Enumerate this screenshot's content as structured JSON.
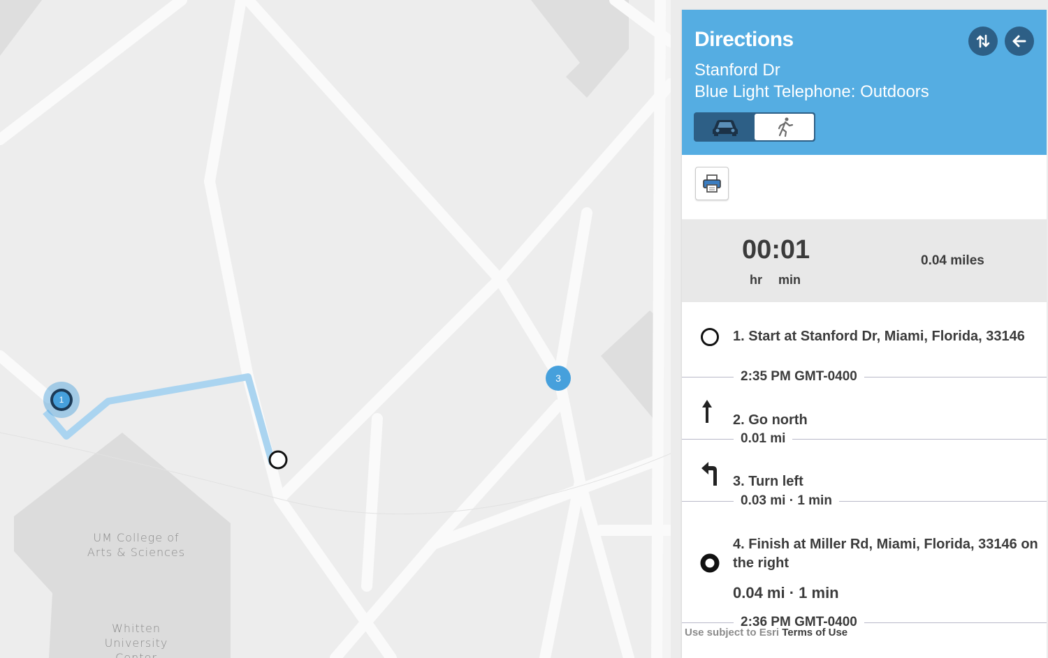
{
  "map": {
    "labels": {
      "college": "UM College of\nArts & Sciences",
      "whitten": "Whitten\nUniversity\nCenter"
    },
    "markers": {
      "stop1": "1",
      "stop3": "3"
    }
  },
  "panel": {
    "title": "Directions",
    "origin": "Stanford Dr",
    "destination": "Blue Light Telephone: Outdoors",
    "travel_modes": {
      "selected": "walking",
      "options": [
        "car-icon",
        "walking-icon"
      ]
    }
  },
  "summary": {
    "time": "00:01",
    "unit_hr": "hr",
    "unit_min": "min",
    "distance": "0.04 miles"
  },
  "steps": [
    {
      "text": "1. Start at Stanford Dr, Miami, Florida, 33146",
      "icon": "start-circle-icon"
    },
    {
      "separator": "2:35 PM GMT-0400"
    },
    {
      "text": "2. Go north",
      "icon": "arrow-up-icon"
    },
    {
      "separator": "0.01 mi"
    },
    {
      "text": "3. Turn left",
      "icon": "turn-left-icon"
    },
    {
      "separator": "0.03 mi · 1 min"
    },
    {
      "text": "4. Finish at Miller Rd, Miami, Florida, 33146  on the right",
      "icon": "finish-circle-icon"
    },
    {
      "total": "0.04 mi · 1 min"
    },
    {
      "separator": "2:36 PM GMT-0400"
    }
  ],
  "footer": {
    "prefix": "Use subject to Esri",
    "link": "Terms of Use"
  },
  "colors": {
    "header": "#55ade2",
    "dark_button": "#2d5f86",
    "route": "#aad4f0",
    "marker": "#46a0dc"
  }
}
